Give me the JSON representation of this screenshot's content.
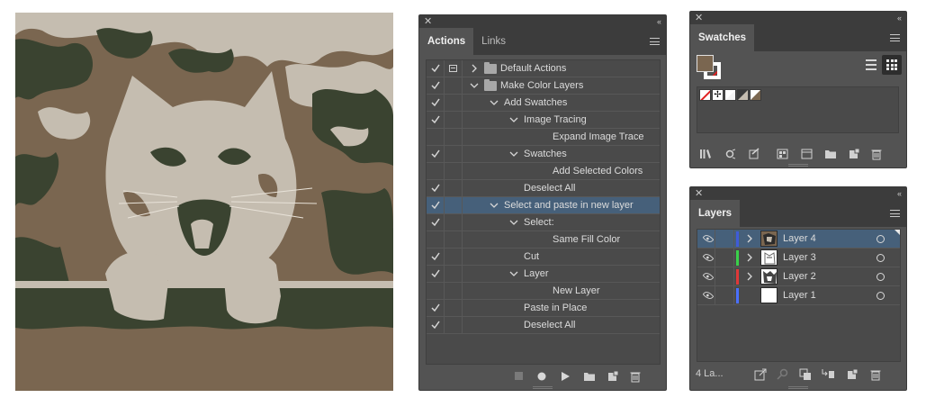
{
  "artwork": {
    "colors": {
      "background": "#7a6650",
      "dark": "#3a4330",
      "light": "#c5bdb0"
    }
  },
  "actions_panel": {
    "tabs": [
      {
        "label": "Actions",
        "active": true
      },
      {
        "label": "Links",
        "active": false
      }
    ],
    "rows": [
      {
        "label": "Default Actions",
        "checked": true,
        "dialog": true,
        "level": 0,
        "folder": true,
        "expanded": false
      },
      {
        "label": "Make Color Layers",
        "checked": true,
        "dialog": false,
        "level": 0,
        "folder": true,
        "expanded": true
      },
      {
        "label": "Add Swatches",
        "checked": true,
        "level": 1,
        "expanded": true
      },
      {
        "label": "Image Tracing",
        "checked": true,
        "level": 2,
        "expanded": true
      },
      {
        "label": "Expand Image Trace",
        "checked": false,
        "level": 3
      },
      {
        "label": "Swatches",
        "checked": true,
        "level": 2,
        "expanded": true
      },
      {
        "label": "Add Selected Colors",
        "checked": false,
        "level": 3
      },
      {
        "label": "Deselect All",
        "checked": true,
        "level": 2
      },
      {
        "label": "Select and paste in new layer",
        "checked": true,
        "level": 1,
        "expanded": true,
        "selected": true
      },
      {
        "label": "Select:",
        "checked": true,
        "level": 2,
        "expanded": true
      },
      {
        "label": "Same Fill Color",
        "checked": false,
        "level": 3
      },
      {
        "label": "Cut",
        "checked": true,
        "level": 2
      },
      {
        "label": "Layer",
        "checked": true,
        "level": 2,
        "expanded": true
      },
      {
        "label": "New Layer",
        "checked": false,
        "level": 3
      },
      {
        "label": "Paste in Place",
        "checked": true,
        "level": 2
      },
      {
        "label": "Deselect All",
        "checked": true,
        "level": 2
      }
    ],
    "footer_icons": [
      "stop-icon",
      "record-icon",
      "play-icon",
      "new-set-icon",
      "new-action-icon",
      "trash-icon"
    ]
  },
  "swatches_panel": {
    "tabs": [
      {
        "label": "Swatches",
        "active": true
      }
    ],
    "fill_color": "#7a6650",
    "footer_icons": [
      "library-icon",
      "show-kinds-icon",
      "swatch-options-icon",
      "color-group-icon",
      "new-color-group-icon",
      "folder-icon",
      "new-swatch-icon",
      "trash-icon"
    ]
  },
  "layers_panel": {
    "tabs": [
      {
        "label": "Layers",
        "active": true
      }
    ],
    "layers": [
      {
        "name": "Layer 4",
        "color": "#3f5cd8",
        "selected": true,
        "has_content": true
      },
      {
        "name": "Layer 3",
        "color": "#3ad04a",
        "selected": false,
        "has_content": true
      },
      {
        "name": "Layer 2",
        "color": "#e03838",
        "selected": false,
        "has_content": true
      },
      {
        "name": "Layer 1",
        "color": "#4a70ff",
        "selected": false,
        "has_content": false
      }
    ],
    "count_label": "4 La...",
    "footer_icons": [
      "export-icon",
      "locate-icon",
      "clipping-mask-icon",
      "new-sublayer-icon",
      "new-layer-icon",
      "trash-icon"
    ]
  }
}
